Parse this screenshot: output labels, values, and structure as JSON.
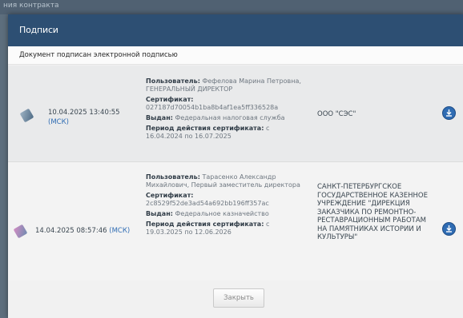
{
  "background": {
    "strip_text": "ния контракта"
  },
  "modal": {
    "title": "Подписи",
    "notice": "Документ подписан электронной подписью",
    "close_label": "Закрыть",
    "colors": {
      "header": "#2d4f73",
      "link": "#2f6cb3",
      "download": "#2f6cb3"
    }
  },
  "signatures": [
    {
      "icon": "signature-icon",
      "datetime": "10.04.2025 13:40:55",
      "timezone": "(МСК)",
      "user_label": "Пользователь:",
      "user": "Фефелова Марина Петровна, ГЕНЕРАЛЬНЫЙ ДИРЕКТОР",
      "cert_label": "Сертификат:",
      "cert": "027187d70054b1ba8b4af1ea5ff336528a",
      "issuer_label": "Выдан:",
      "issuer": "Федеральная налоговая служба",
      "period_label": "Период действия сертификата:",
      "period": "с 16.04.2024 по 16.07.2025",
      "organization": "ООО \"СЭС\"",
      "download_icon": "download-icon"
    },
    {
      "icon": "signature-icon",
      "datetime": "14.04.2025 08:57:46",
      "timezone": "(МСК)",
      "user_label": "Пользователь:",
      "user": "Тарасенко Александр Михайлович, Первый заместитель директора",
      "cert_label": "Сертификат:",
      "cert": "2c8529f52de3ad54a692bb196ff357ac",
      "issuer_label": "Выдан:",
      "issuer": "Федеральное казначейство",
      "period_label": "Период действия сертификата:",
      "period": "с 19.03.2025 по 12.06.2026",
      "organization": "САНКТ-ПЕТЕРБУРГСКОЕ ГОСУДАРСТВЕННОЕ КАЗЕННОЕ УЧРЕЖДЕНИЕ \"ДИРЕКЦИЯ ЗАКАЗЧИКА ПО РЕМОНТНО-РЕСТАВРАЦИОННЫМ РАБОТАМ НА ПАМЯТНИКАХ ИСТОРИИ И КУЛЬТУРЫ\"",
      "download_icon": "download-icon"
    }
  ]
}
